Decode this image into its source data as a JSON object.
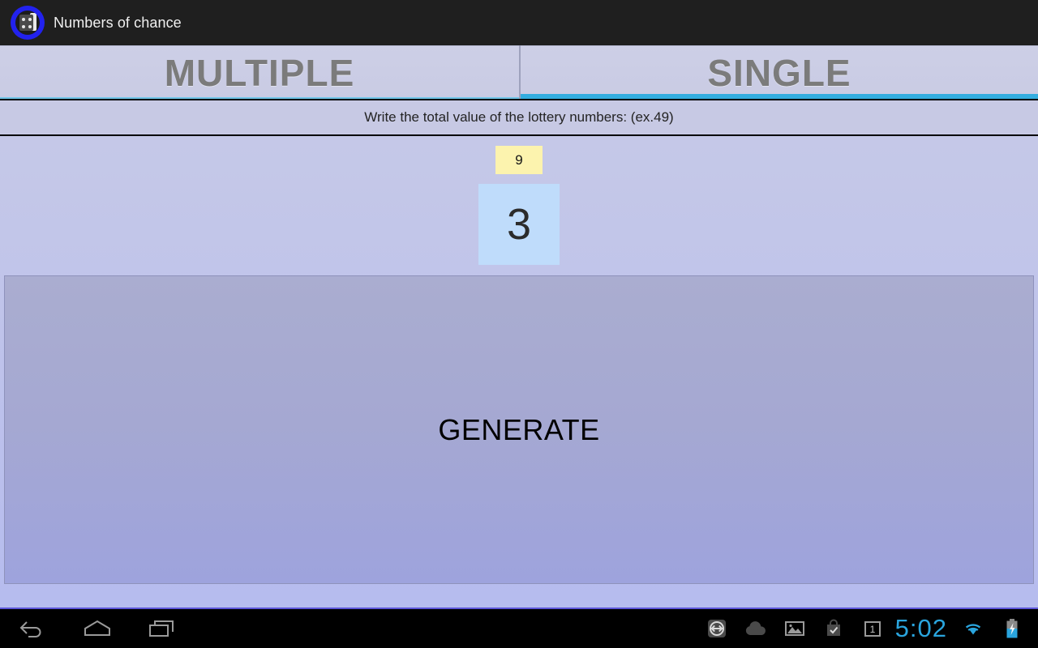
{
  "window": {
    "app_title": "Numbers of chance",
    "app_icon": "dice-cards-icon"
  },
  "tabs": [
    {
      "label": "MULTIPLE",
      "active": false,
      "underline_color": "#6fc4e8"
    },
    {
      "label": "SINGLE",
      "active": true,
      "underline_color": "#33ade0"
    }
  ],
  "instruction": {
    "text": "Write the total value of the lottery numbers: (ex.49)"
  },
  "form": {
    "total_value_input": {
      "value": "9",
      "placeholder": "",
      "background": "#fcf3ae"
    },
    "result_box": {
      "value": "3",
      "background": "#bfdcfb"
    },
    "generate_button": {
      "label": "GENERATE"
    }
  },
  "navbar": {
    "back": "back-icon",
    "home": "home-icon",
    "recents": "recent-apps-icon",
    "status_icons": [
      "remote-access-icon",
      "cloud-upload-icon",
      "photo-icon",
      "shopping-bag-check-icon",
      "calendar-icon"
    ],
    "calendar_day": "1",
    "clock": "5:02",
    "wifi": "wifi-icon",
    "battery": "battery-charging-icon",
    "accent_color": "#2aa5de"
  }
}
